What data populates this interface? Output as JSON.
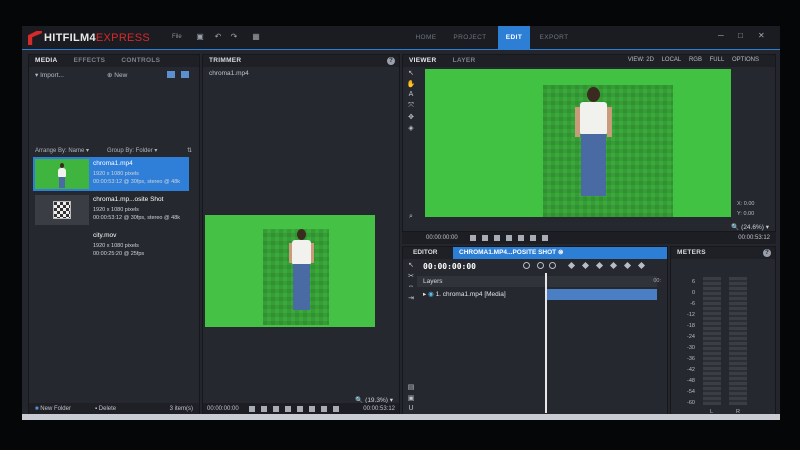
{
  "app": {
    "logo_main": "HITFILM4",
    "logo_sub": "EXPRESS",
    "file_menu": "File",
    "accent": "#2d7fd6"
  },
  "nav": {
    "home": "HOME",
    "project": "PROJECT",
    "edit": "EDIT",
    "export": "EXPORT"
  },
  "media_panel": {
    "tabs": [
      "MEDIA",
      "EFFECTS",
      "CONTROLS"
    ],
    "import_label": "Import...",
    "new_label": "New",
    "arrange_label": "Arrange By: Name",
    "group_label": "Group By: Folder",
    "items": [
      {
        "name": "chroma1.mp4",
        "line1": "1920 x 1080 pixels",
        "line2": "00:00:53:12 @ 30fps, stereo @ 48k"
      },
      {
        "name": "chroma1.mp...osite Shot",
        "line1": "1920 x 1080 pixels",
        "line2": "00:00:53:12 @ 30fps, stereo @ 48k"
      },
      {
        "name": "city.mov",
        "line1": "1920 x 1080 pixels",
        "line2": "00:00:25:20 @ 25fps"
      }
    ],
    "new_folder": "New Folder",
    "delete": "Delete",
    "count": "3 item(s)"
  },
  "trimmer": {
    "title": "TRIMMER",
    "clip_name": "chroma1.mp4",
    "zoom": "(19.3%)",
    "tc_start": "00:00:00:00",
    "tc_end": "00:00:53:12"
  },
  "viewer": {
    "tabs": [
      "VIEWER",
      "LAYER"
    ],
    "view_label": "VIEW: 2D",
    "local_label": "LOCAL",
    "rgb_label": "RGB",
    "full_label": "FULL",
    "options_label": "OPTIONS",
    "badge": "2D",
    "x_label": "X:",
    "x_val": "0.00",
    "y_label": "Y:",
    "y_val": "0.00",
    "zoom": "(24.6%)",
    "tc_start": "00:00:00:00",
    "tc_end": "00:00:53:12"
  },
  "editor": {
    "tab_editor": "EDITOR",
    "tab_comp": "CHROMA1.MP4...POSITE SHOT",
    "timecode": "00:00:00:00",
    "layers_label": "Layers",
    "layer_row": "1. chroma1.mp4 [Media]",
    "end_tc": "00:"
  },
  "meters": {
    "title": "METERS",
    "scale": [
      "6",
      "0",
      "-6",
      "-12",
      "-18",
      "-24",
      "-30",
      "-36",
      "-42",
      "-48",
      "-54",
      "-60"
    ],
    "left": "L",
    "right": "R"
  }
}
